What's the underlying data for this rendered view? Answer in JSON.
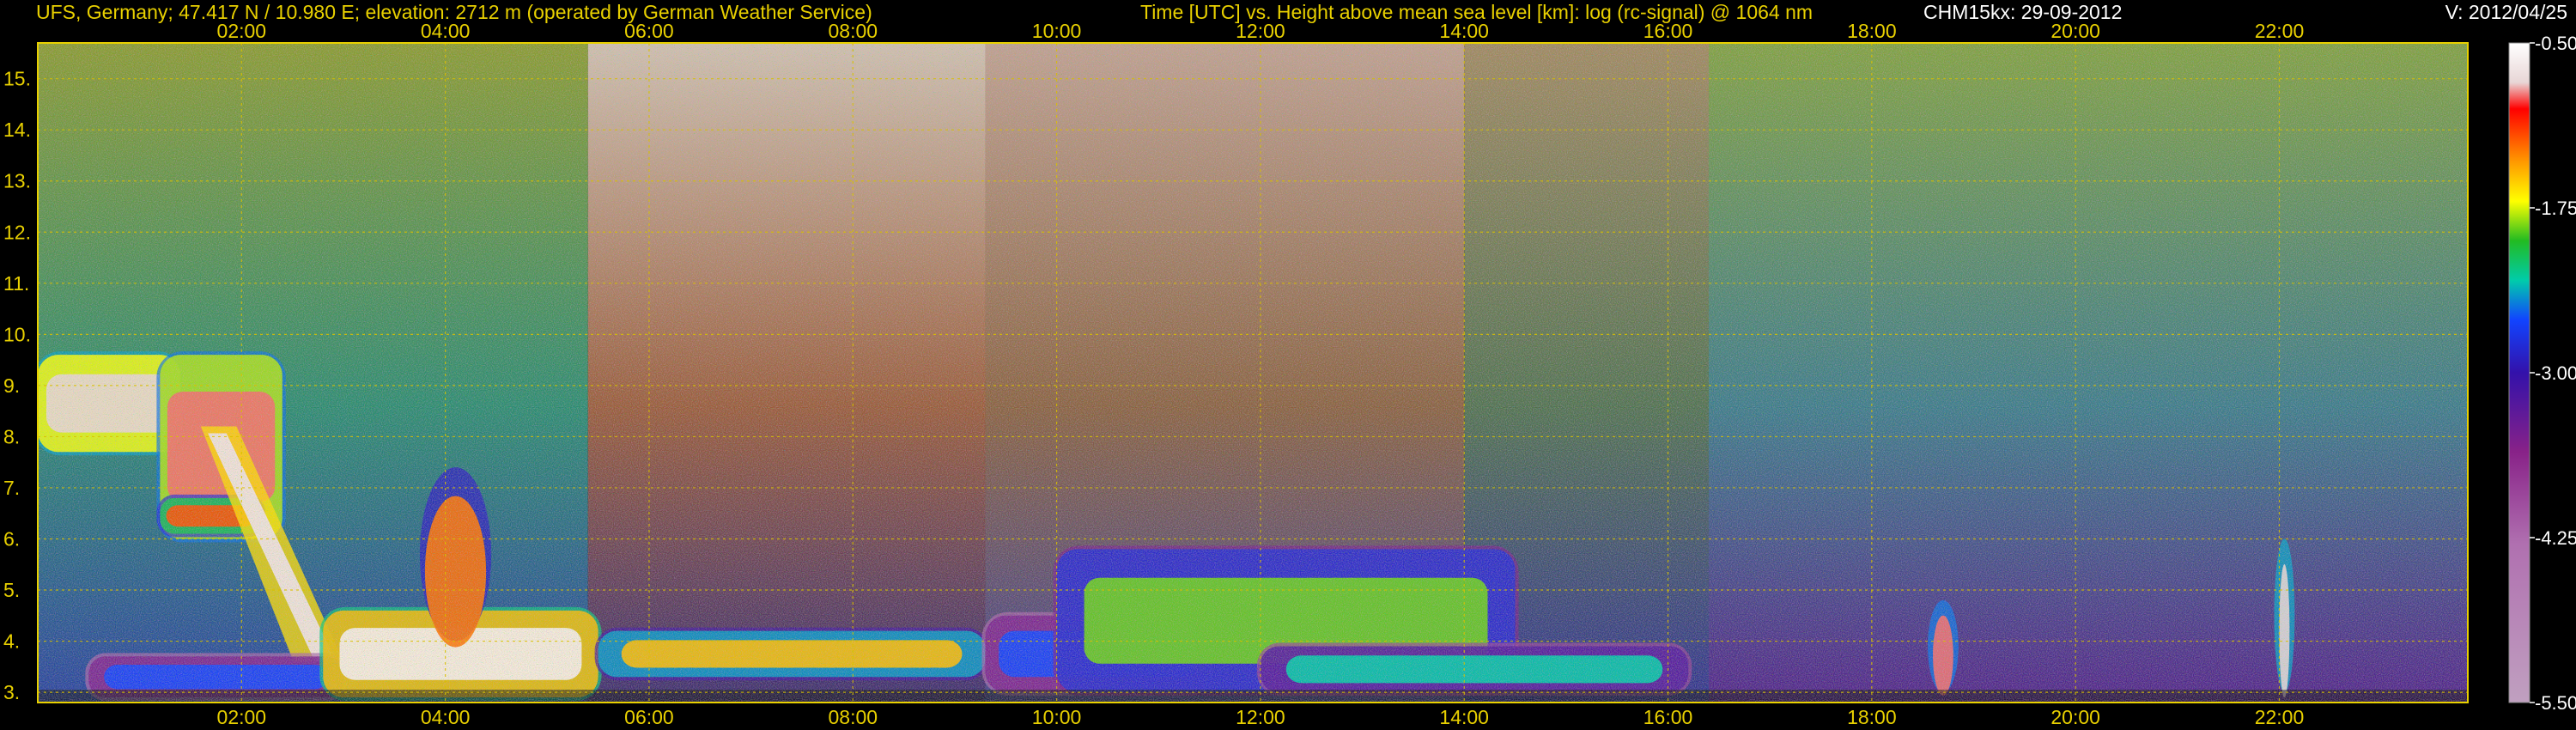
{
  "header": {
    "station": "UFS, Germany; 47.417 N / 10.980 E; elevation: 2712 m  (operated by German Weather Service)",
    "description": "Time [UTC] vs. Height above mean sea level [km]: log (rc-signal) @ 1064 nm",
    "instrument": "CHM15kx: 29-09-2012",
    "version": "V: 2012/04/25"
  },
  "chart_data": {
    "type": "heatmap",
    "title": "",
    "xlabel": "",
    "ylabel": "",
    "x_unit": "hours UTC",
    "x_range": [
      0,
      23.85
    ],
    "x_ticks": [
      2,
      4,
      6,
      8,
      10,
      12,
      14,
      16,
      18,
      20,
      22
    ],
    "x_tick_labels": [
      "02:00",
      "04:00",
      "06:00",
      "08:00",
      "10:00",
      "12:00",
      "14:00",
      "16:00",
      "18:00",
      "20:00",
      "22:00"
    ],
    "y_unit": "km",
    "y_range": [
      2.8,
      15.7
    ],
    "y_ticks": [
      3,
      4,
      5,
      6,
      7,
      8,
      9,
      10,
      11,
      12,
      13,
      14,
      15
    ],
    "y_tick_labels": [
      "3.",
      "4.",
      "5.",
      "6.",
      "7.",
      "8.",
      "9.",
      "10.",
      "11.",
      "12.",
      "13.",
      "14.",
      "15."
    ],
    "grid": true,
    "colorbar": {
      "range": [
        -5.5,
        -0.5
      ],
      "ticks": [
        -0.5,
        -1.75,
        -3.0,
        -4.25,
        -5.5
      ],
      "tick_labels": [
        "-0.50",
        "-1.75",
        "-3.00",
        "-4.25",
        "-5.50"
      ],
      "stops": [
        {
          "value": -0.5,
          "color": "#ffffff"
        },
        {
          "value": -0.8,
          "color": "#e8d6d6"
        },
        {
          "value": -1.0,
          "color": "#ff0000"
        },
        {
          "value": -1.4,
          "color": "#ff9900"
        },
        {
          "value": -1.7,
          "color": "#ffff00"
        },
        {
          "value": -2.0,
          "color": "#22bb22"
        },
        {
          "value": -2.3,
          "color": "#00ccaa"
        },
        {
          "value": -2.6,
          "color": "#1144ff"
        },
        {
          "value": -3.0,
          "color": "#3311aa"
        },
        {
          "value": -3.6,
          "color": "#882288"
        },
        {
          "value": -4.3,
          "color": "#b070b0"
        },
        {
          "value": -5.5,
          "color": "#c0a0c0"
        }
      ]
    },
    "features": [
      {
        "kind": "cirrus",
        "t0": 0.0,
        "t1": 1.4,
        "h0": 7.7,
        "h1": 9.6,
        "level": -0.8
      },
      {
        "kind": "cirrus",
        "t0": 1.2,
        "t1": 2.4,
        "h0": 6.0,
        "h1": 9.6,
        "level": -0.9
      },
      {
        "kind": "cloud",
        "t0": 1.2,
        "t1": 2.2,
        "h0": 6.1,
        "h1": 6.8,
        "level": -1.2
      },
      {
        "kind": "fall",
        "t0": 1.6,
        "t1": 3.0,
        "h0": 3.6,
        "h1": 8.2,
        "level": -0.7
      },
      {
        "kind": "residual",
        "t0": 0.5,
        "t1": 3.0,
        "h0": 2.9,
        "h1": 3.7,
        "level": -2.6
      },
      {
        "kind": "boundary_layer",
        "t0": 2.8,
        "t1": 5.5,
        "h0": 2.9,
        "h1": 4.6,
        "level": -0.6
      },
      {
        "kind": "plume",
        "t0": 3.8,
        "t1": 4.4,
        "h0": 4.0,
        "h1": 7.4,
        "level": -1.3
      },
      {
        "kind": "boundary_layer",
        "t0": 5.5,
        "t1": 9.3,
        "h0": 3.3,
        "h1": 4.2,
        "level": -1.5
      },
      {
        "kind": "boundary_layer",
        "t0": 9.3,
        "t1": 11.5,
        "h0": 3.0,
        "h1": 4.5,
        "level": -2.6
      },
      {
        "kind": "convection",
        "t0": 10.0,
        "t1": 14.5,
        "h0": 3.0,
        "h1": 5.8,
        "level": -1.9
      },
      {
        "kind": "boundary_layer",
        "t0": 12.0,
        "t1": 16.2,
        "h0": 3.0,
        "h1": 3.9,
        "level": -2.3
      },
      {
        "kind": "plume",
        "t0": 18.6,
        "t1": 18.8,
        "h0": 3.0,
        "h1": 4.8,
        "level": -0.9
      },
      {
        "kind": "plume",
        "t0": 22.0,
        "t1": 22.1,
        "h0": 3.0,
        "h1": 6.0,
        "level": -0.8
      }
    ],
    "background_segments": [
      {
        "t0": 0.0,
        "t1": 5.4,
        "top": "#8a9a30",
        "mid": "#2a8a70",
        "low": "#2840a0"
      },
      {
        "t0": 5.4,
        "t1": 9.3,
        "top": "#d0c0b0",
        "mid": "#9a5a3a",
        "low": "#3a2a70"
      },
      {
        "t0": 9.3,
        "t1": 14.0,
        "top": "#c0a090",
        "mid": "#8a6040",
        "low": "#404090"
      },
      {
        "t0": 14.0,
        "t1": 16.4,
        "top": "#a08860",
        "mid": "#507050",
        "low": "#303090"
      },
      {
        "t0": 16.4,
        "t1": 23.85,
        "top": "#80a040",
        "mid": "#3a7a8a",
        "low": "#50208a"
      }
    ]
  }
}
